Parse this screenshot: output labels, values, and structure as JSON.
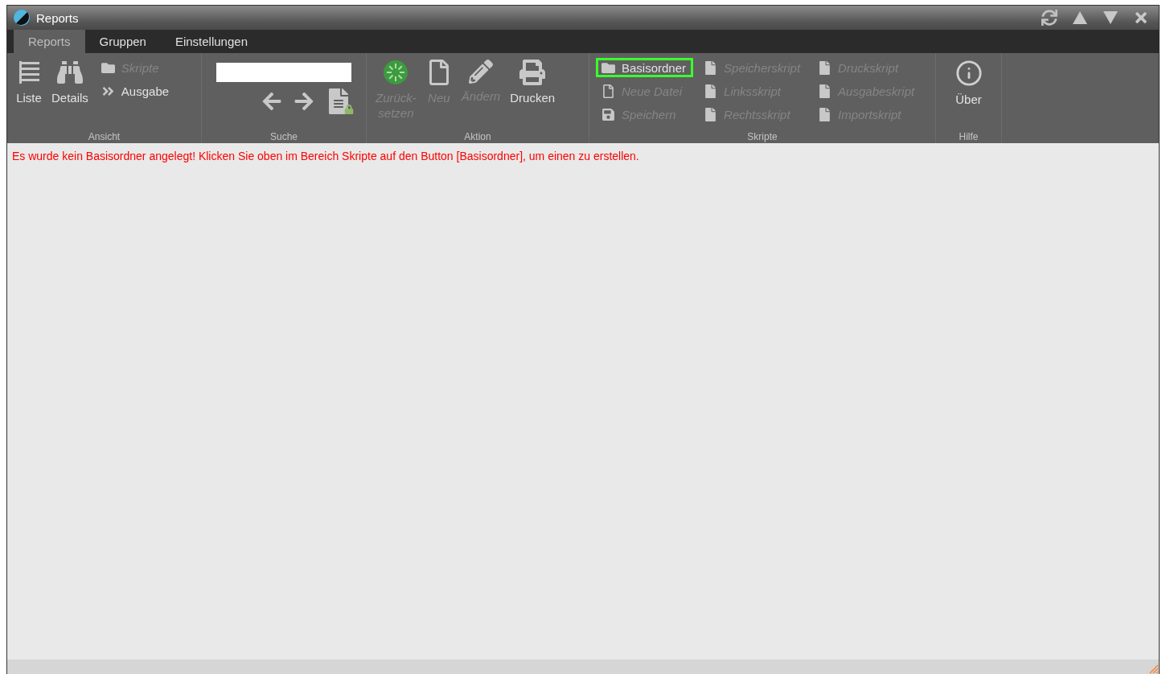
{
  "window": {
    "title": "Reports"
  },
  "tabs": [
    {
      "label": "Reports",
      "selected": true
    },
    {
      "label": "Gruppen",
      "selected": false
    },
    {
      "label": "Einstellungen",
      "selected": false
    }
  ],
  "ribbon": {
    "groups": [
      {
        "label": "Ansicht",
        "kind": "buttons",
        "large": [
          {
            "label": "Liste",
            "disabled": false
          },
          {
            "label": "Details",
            "disabled": false
          }
        ],
        "small_columns": [
          [
            {
              "label": "Skripte",
              "disabled": true,
              "highlighted": false
            },
            {
              "label": "Ausgabe",
              "disabled": false,
              "highlighted": false
            }
          ]
        ]
      },
      {
        "label": "Suche",
        "kind": "search"
      },
      {
        "label": "Aktion",
        "kind": "buttons",
        "large": [
          {
            "label": "Zurück-\nsetzen",
            "disabled": true
          },
          {
            "label": "Neu",
            "disabled": true
          },
          {
            "label": "Ändern",
            "disabled": true
          },
          {
            "label": "Drucken",
            "disabled": false
          }
        ]
      },
      {
        "label": "Skripte",
        "kind": "buttons",
        "small_columns": [
          [
            {
              "label": "Basisordner",
              "disabled": false,
              "highlighted": true
            },
            {
              "label": "Neue Datei",
              "disabled": true,
              "highlighted": false
            },
            {
              "label": "Speichern",
              "disabled": true,
              "highlighted": false
            }
          ],
          [
            {
              "label": "Speicherskript",
              "disabled": true,
              "highlighted": false
            },
            {
              "label": "Linksskript",
              "disabled": true,
              "highlighted": false
            },
            {
              "label": "Rechtsskript",
              "disabled": true,
              "highlighted": false
            }
          ],
          [
            {
              "label": "Druckskript",
              "disabled": true,
              "highlighted": false
            },
            {
              "label": "Ausgabeskript",
              "disabled": true,
              "highlighted": false
            },
            {
              "label": "Importskript",
              "disabled": true,
              "highlighted": false
            }
          ]
        ]
      },
      {
        "label": "Hilfe",
        "kind": "buttons",
        "large": [
          {
            "label": "Über",
            "disabled": false
          }
        ]
      }
    ]
  },
  "message": "Es wurde kein Basisordner angelegt! Klicken Sie oben im Bereich Skripte auf den Button [Basisordner], um einen zu erstellen."
}
